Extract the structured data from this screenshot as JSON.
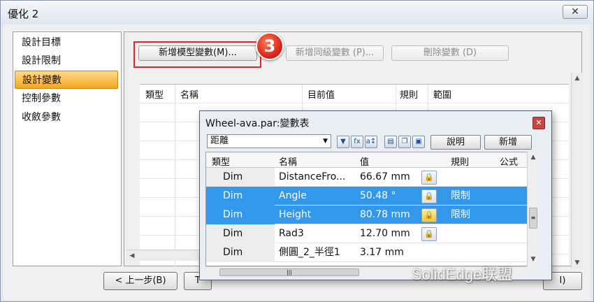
{
  "window": {
    "title": "優化 2",
    "close_glyph": "✕"
  },
  "nav": {
    "items": [
      {
        "label": "設計目標",
        "selected": false
      },
      {
        "label": "設計限制",
        "selected": false
      },
      {
        "label": "設計變數",
        "selected": true
      },
      {
        "label": "控制參數",
        "selected": false
      },
      {
        "label": "收斂參數",
        "selected": false
      }
    ]
  },
  "main": {
    "add_model_var_button": "新增模型變數(M)...",
    "add_sibling_var_button": "新增同級變數 (P)...",
    "delete_var_button": "刪除變數 (D)",
    "step_number": "3",
    "columns": [
      "類型",
      "名稱",
      "目前值",
      "規則",
      "範圍"
    ]
  },
  "footer": {
    "prev_button": "< 上一步(B)",
    "next_button_partial": "T",
    "last_button_partial": "I)"
  },
  "variable_table": {
    "title": "Wheel-ava.par:變數表",
    "filter": "距離",
    "help_button": "說明",
    "add_button": "新增",
    "columns": [
      "類型",
      "名稱",
      "值",
      "規則",
      "公式"
    ],
    "rows": [
      {
        "type": "Dim",
        "name": "DistanceFro...",
        "value": "66.67 mm",
        "rule": "",
        "locked": true,
        "selected": false
      },
      {
        "type": "Dim",
        "name": "Angle",
        "value": "50.48 °",
        "rule": "限制",
        "locked": true,
        "selected": true
      },
      {
        "type": "Dim",
        "name": "Height",
        "value": "80.78 mm",
        "rule": "限制",
        "locked": true,
        "selected": true
      },
      {
        "type": "Dim",
        "name": "Rad3",
        "value": "12.70 mm",
        "rule": "",
        "locked": true,
        "selected": false
      },
      {
        "type": "Dim",
        "name": "側圓_2_半徑1",
        "value": "3.17 mm",
        "rule": "",
        "locked": false,
        "selected": false
      }
    ]
  },
  "watermark": "SolidEdge联盟",
  "colors": {
    "selection": "#3398ea",
    "nav_selected": "#f5a623",
    "highlight_border": "#e0282b",
    "step_badge": "#d41c10"
  }
}
